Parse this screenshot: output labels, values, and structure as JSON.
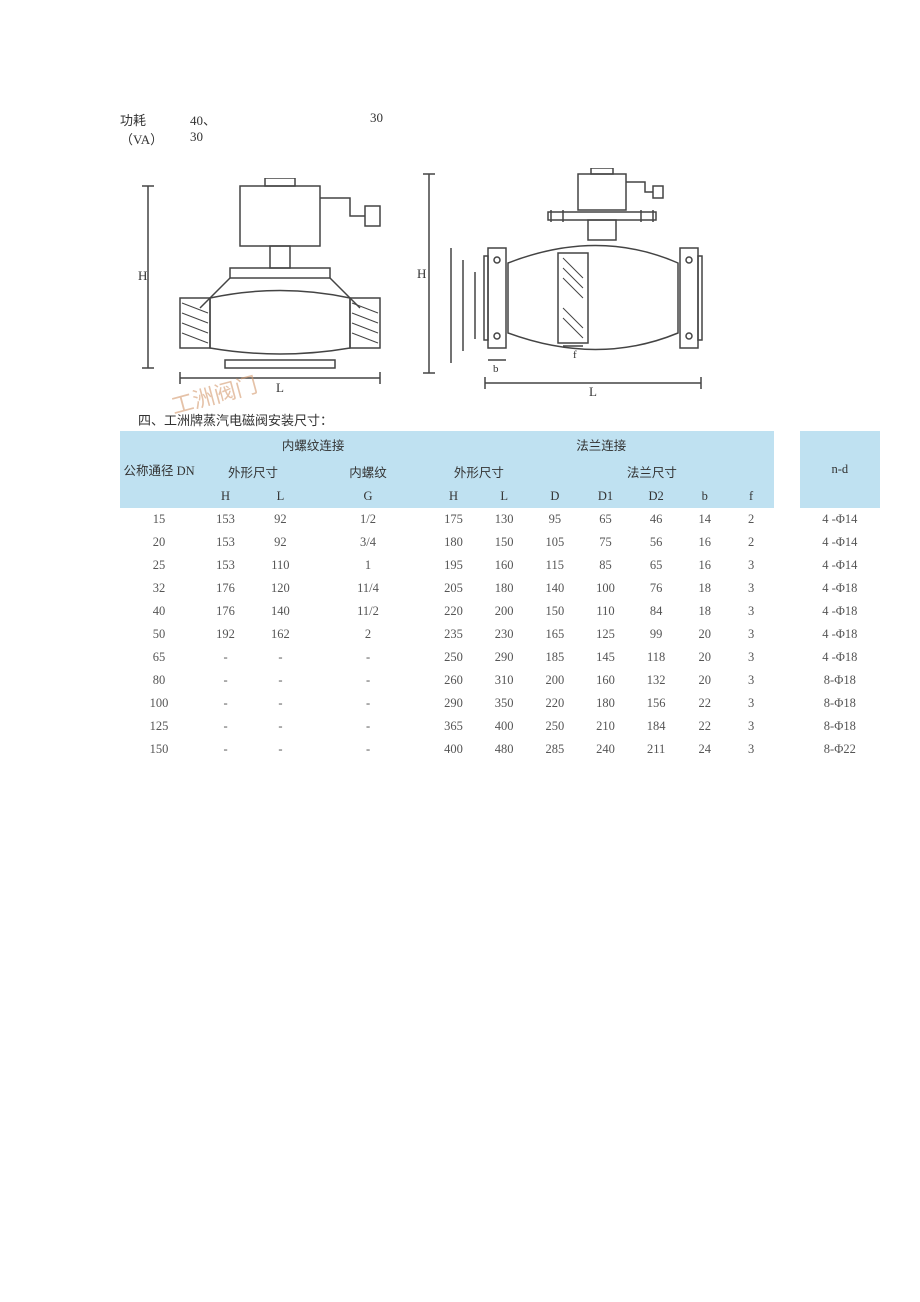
{
  "top": {
    "label1": "功耗",
    "val1a": "40、",
    "val1b": "30",
    "label2": "（VA）",
    "val2a": "30"
  },
  "diagram": {
    "watermark": "工洲阀门",
    "labels": {
      "H": "H",
      "L": "L",
      "f": "f",
      "b": "b"
    }
  },
  "section_title": "四、工洲牌蒸汽电磁阀安装尺寸：",
  "table": {
    "col_dn": "公称通径 DN",
    "group_thread": "内螺纹连接",
    "group_flange": "法兰连接",
    "sub_outer": "外形尺寸",
    "sub_thread": "内螺纹",
    "sub_flange_dim": "法兰尺寸",
    "headers": {
      "H": "H",
      "L": "L",
      "G": "G",
      "H2": "H",
      "L2": "L",
      "D": "D",
      "D1": "D1",
      "D2": "D2",
      "b": "b",
      "f": "f",
      "nd": "n-d"
    },
    "rows": [
      {
        "dn": "15",
        "th": "153",
        "tl": "92",
        "g": "1/2",
        "fh": "175",
        "fl": "130",
        "d": "95",
        "d1": "65",
        "d2": "46",
        "b": "14",
        "f": "2",
        "nd": "4 -Φ14"
      },
      {
        "dn": "20",
        "th": "153",
        "tl": "92",
        "g": "3/4",
        "fh": "180",
        "fl": "150",
        "d": "105",
        "d1": "75",
        "d2": "56",
        "b": "16",
        "f": "2",
        "nd": "4 -Φ14"
      },
      {
        "dn": "25",
        "th": "153",
        "tl": "110",
        "g": "1",
        "fh": "195",
        "fl": "160",
        "d": "115",
        "d1": "85",
        "d2": "65",
        "b": "16",
        "f": "3",
        "nd": "4 -Φ14"
      },
      {
        "dn": "32",
        "th": "176",
        "tl": "120",
        "g": "11/4",
        "fh": "205",
        "fl": "180",
        "d": "140",
        "d1": "100",
        "d2": "76",
        "b": "18",
        "f": "3",
        "nd": "4 -Φ18"
      },
      {
        "dn": "40",
        "th": "176",
        "tl": "140",
        "g": "11/2",
        "fh": "220",
        "fl": "200",
        "d": "150",
        "d1": "110",
        "d2": "84",
        "b": "18",
        "f": "3",
        "nd": "4 -Φ18"
      },
      {
        "dn": "50",
        "th": "192",
        "tl": "162",
        "g": "2",
        "fh": "235",
        "fl": "230",
        "d": "165",
        "d1": "125",
        "d2": "99",
        "b": "20",
        "f": "3",
        "nd": "4 -Φ18"
      },
      {
        "dn": "65",
        "th": "-",
        "tl": "-",
        "g": "-",
        "fh": "250",
        "fl": "290",
        "d": "185",
        "d1": "145",
        "d2": "118",
        "b": "20",
        "f": "3",
        "nd": "4 -Φ18"
      },
      {
        "dn": "80",
        "th": "-",
        "tl": "-",
        "g": "-",
        "fh": "260",
        "fl": "310",
        "d": "200",
        "d1": "160",
        "d2": "132",
        "b": "20",
        "f": "3",
        "nd": "8-Φ18"
      },
      {
        "dn": "100",
        "th": "-",
        "tl": "-",
        "g": "-",
        "fh": "290",
        "fl": "350",
        "d": "220",
        "d1": "180",
        "d2": "156",
        "b": "22",
        "f": "3",
        "nd": "8-Φ18"
      },
      {
        "dn": "125",
        "th": "-",
        "tl": "-",
        "g": "-",
        "fh": "365",
        "fl": "400",
        "d": "250",
        "d1": "210",
        "d2": "184",
        "b": "22",
        "f": "3",
        "nd": "8-Φ18"
      },
      {
        "dn": "150",
        "th": "-",
        "tl": "-",
        "g": "-",
        "fh": "400",
        "fl": "480",
        "d": "285",
        "d1": "240",
        "d2": "211",
        "b": "24",
        "f": "3",
        "nd": "8-Φ22"
      }
    ]
  }
}
